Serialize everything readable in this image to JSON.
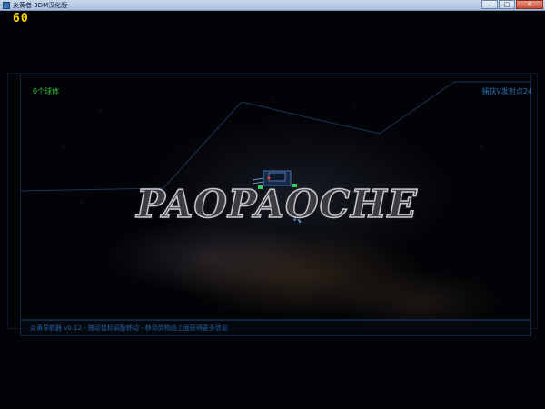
{
  "window": {
    "title": "炎黄者 3DM汉化版",
    "minimize_label": "–",
    "maximize_label": "□",
    "close_label": "✕"
  },
  "hud": {
    "fps": "60",
    "ball_count": "0个球体",
    "waypoint": "捕获V发射点24",
    "status": "炎黄导航器 v0.12 - 拖动鼠标调整移动 - 移动到物品上面获得更多信息"
  },
  "watermark": {
    "text": "PAOPAOCHE"
  },
  "colors": {
    "fps": "#ffd800",
    "ball_count": "#2bbf38",
    "hud_blue": "#2c6fb2",
    "background": "#020306"
  }
}
